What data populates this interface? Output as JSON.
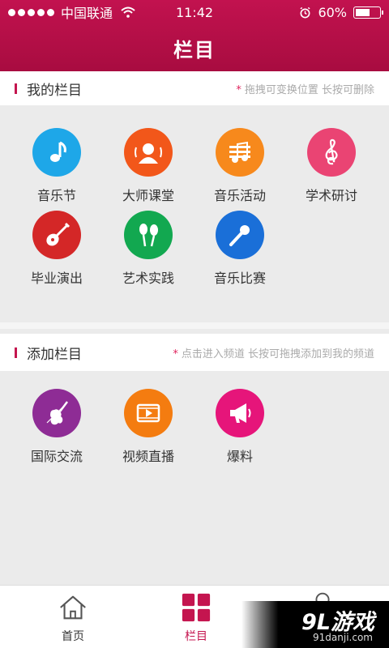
{
  "status": {
    "carrier": "中国联通",
    "time": "11:42",
    "battery": "60%",
    "battery_level": 0.6
  },
  "header": {
    "title": "栏目"
  },
  "my_section": {
    "title": "我的栏目",
    "hint_star": "*",
    "hint": "拖拽可变换位置  长按可删除"
  },
  "my_items": [
    {
      "label": "音乐节",
      "icon": "music-note-icon",
      "color": "#1ea7e8"
    },
    {
      "label": "大师课堂",
      "icon": "teacher-icon",
      "color": "#f2571a"
    },
    {
      "label": "音乐活动",
      "icon": "music-activity-icon",
      "color": "#f7891c"
    },
    {
      "label": "学术研讨",
      "icon": "treble-clef-icon",
      "color": "#ea4473"
    },
    {
      "label": "毕业演出",
      "icon": "guitar-icon",
      "color": "#d42727"
    },
    {
      "label": "艺术实践",
      "icon": "maracas-icon",
      "color": "#12a850"
    },
    {
      "label": "音乐比赛",
      "icon": "microphone-icon",
      "color": "#1a6fd8"
    }
  ],
  "add_section": {
    "title": "添加栏目",
    "hint_star": "*",
    "hint": "点击进入频道  长按可拖拽添加到我的频道"
  },
  "add_items": [
    {
      "label": "国际交流",
      "icon": "violin-icon",
      "color": "#8e2c95"
    },
    {
      "label": "视频直播",
      "icon": "video-play-icon",
      "color": "#f47c10"
    },
    {
      "label": "爆料",
      "icon": "megaphone-icon",
      "color": "#e6157a"
    }
  ],
  "tabs": [
    {
      "label": "首页",
      "icon": "home-icon"
    },
    {
      "label": "栏目",
      "icon": "grid-icon"
    }
  ],
  "watermark": {
    "main": "9L游戏",
    "sub": "91danji.com"
  }
}
